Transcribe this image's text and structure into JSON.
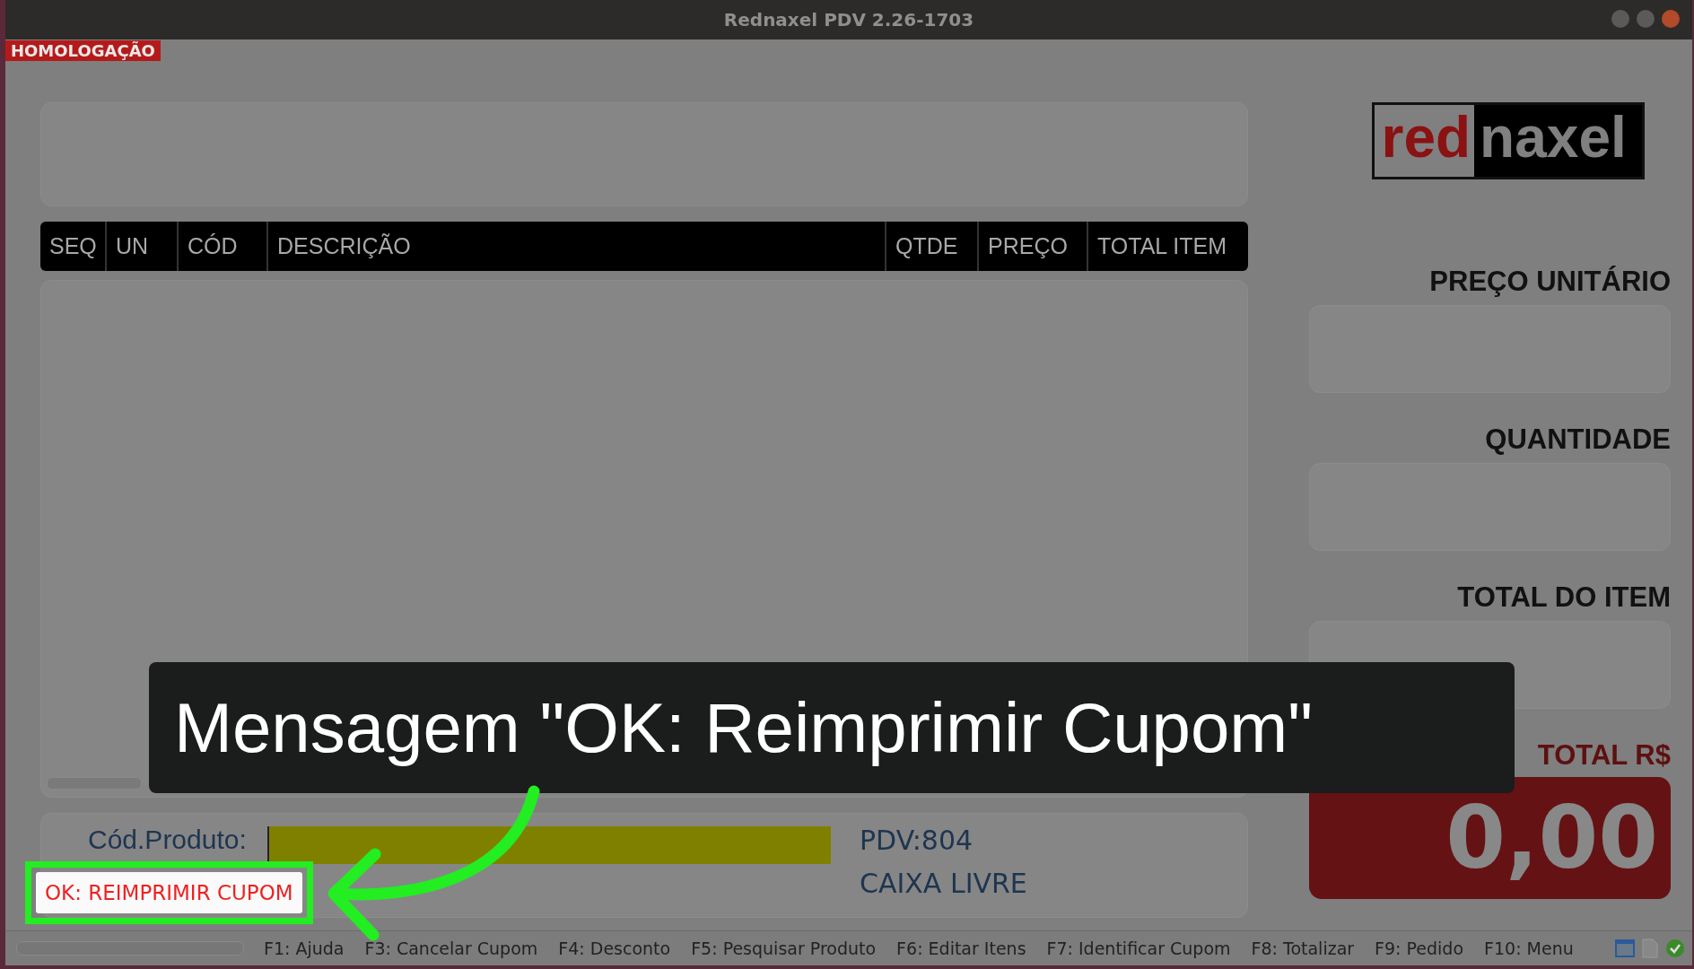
{
  "window": {
    "title": "Rednaxel PDV 2.26-1703"
  },
  "environment_badge": "HOMOLOGAÇÃO",
  "logo": [
    "red",
    "naxel"
  ],
  "table": {
    "columns": [
      "SEQ",
      "UN",
      "CÓD",
      "DESCRIÇÃO",
      "QTDE",
      "PREÇO",
      "TOTAL ITEM"
    ]
  },
  "product_entry": {
    "label": "Cód.Produto:"
  },
  "pos_info": {
    "terminal": "PDV:804",
    "status": "CAIXA LIVRE"
  },
  "message": "OK: REIMPRIMIR CUPOM",
  "side_fields": [
    {
      "label": "PREÇO UNITÁRIO"
    },
    {
      "label": "QUANTIDADE"
    },
    {
      "label": "TOTAL DO ITEM"
    }
  ],
  "total": {
    "label": "TOTAL R$",
    "value": "0,00"
  },
  "shortcuts": [
    "F1: Ajuda",
    "F3: Cancelar Cupom",
    "F4: Desconto",
    "F5: Pesquisar Produto",
    "F6: Editar Itens",
    "F7: Identificar Cupom",
    "F8: Totalizar",
    "F9: Pedido",
    "F10: Menu"
  ],
  "annotation": {
    "caption": "Mensagem \"OK: Reimprimir Cupom\""
  }
}
